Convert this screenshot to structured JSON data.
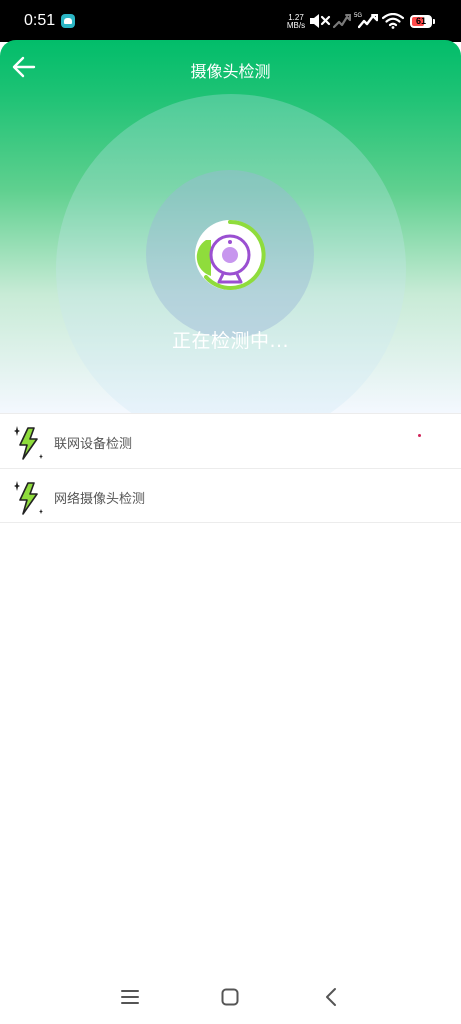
{
  "status_bar": {
    "time": "0:51",
    "net_speed_value": "1.27",
    "net_speed_unit": "MB/s",
    "network_type": "5G",
    "battery_level": "61",
    "icons": [
      "app-notification-icon",
      "mute-icon",
      "signal-icon",
      "signal-5g-icon",
      "wifi-icon",
      "battery-icon"
    ]
  },
  "header": {
    "title": "摄像头检测",
    "back_icon": "back-arrow-icon"
  },
  "scan": {
    "status_text": "正在检测中...",
    "icon": "webcam-icon"
  },
  "check_items": [
    {
      "label": "联网设备检测",
      "icon": "lightning-icon",
      "indicator": "red-dot"
    },
    {
      "label": "网络摄像头检测",
      "icon": "lightning-icon"
    }
  ],
  "nav_bar": {
    "icons": [
      "menu-icon",
      "home-icon",
      "back-icon"
    ]
  },
  "colors": {
    "brand_green": "#02bd6a",
    "camera_purple": "#9a4fd1",
    "bolt_green": "#8fdc3c"
  }
}
